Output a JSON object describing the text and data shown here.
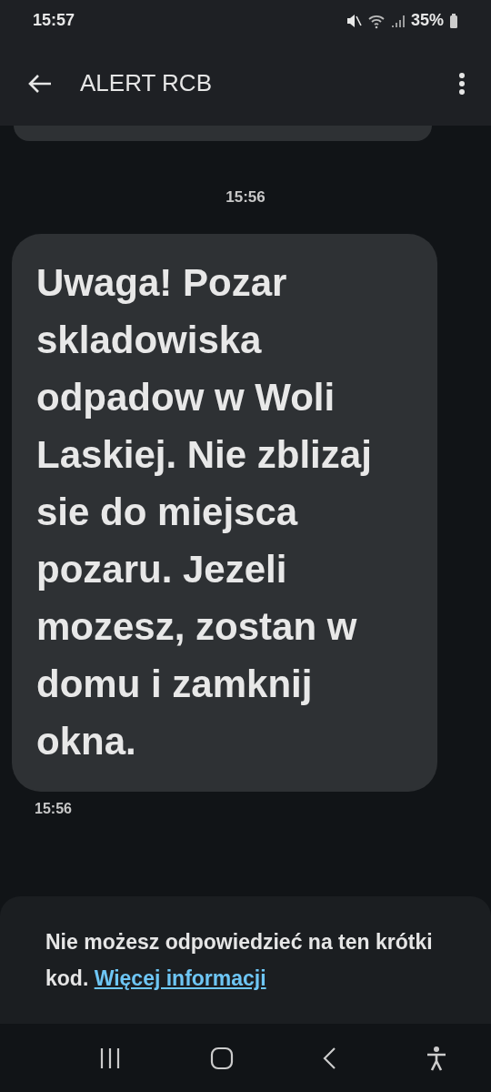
{
  "status_bar": {
    "time": "15:57",
    "battery": "35%"
  },
  "header": {
    "title": "ALERT RCB"
  },
  "conversation": {
    "date_stamp": "15:56",
    "messages": [
      {
        "kind": "partial"
      },
      {
        "kind": "incoming",
        "text": "Uwaga! Pozar skladowiska odpadow w Woli Laskiej. Nie zblizaj sie do miejsca pozaru. Jezeli mozesz, zostan w domu i zamknij okna.",
        "time": "15:56"
      }
    ]
  },
  "reply_notice": {
    "text": "Nie możesz odpowiedzieć na ten krótki kod.",
    "link": "Więcej informacji"
  }
}
